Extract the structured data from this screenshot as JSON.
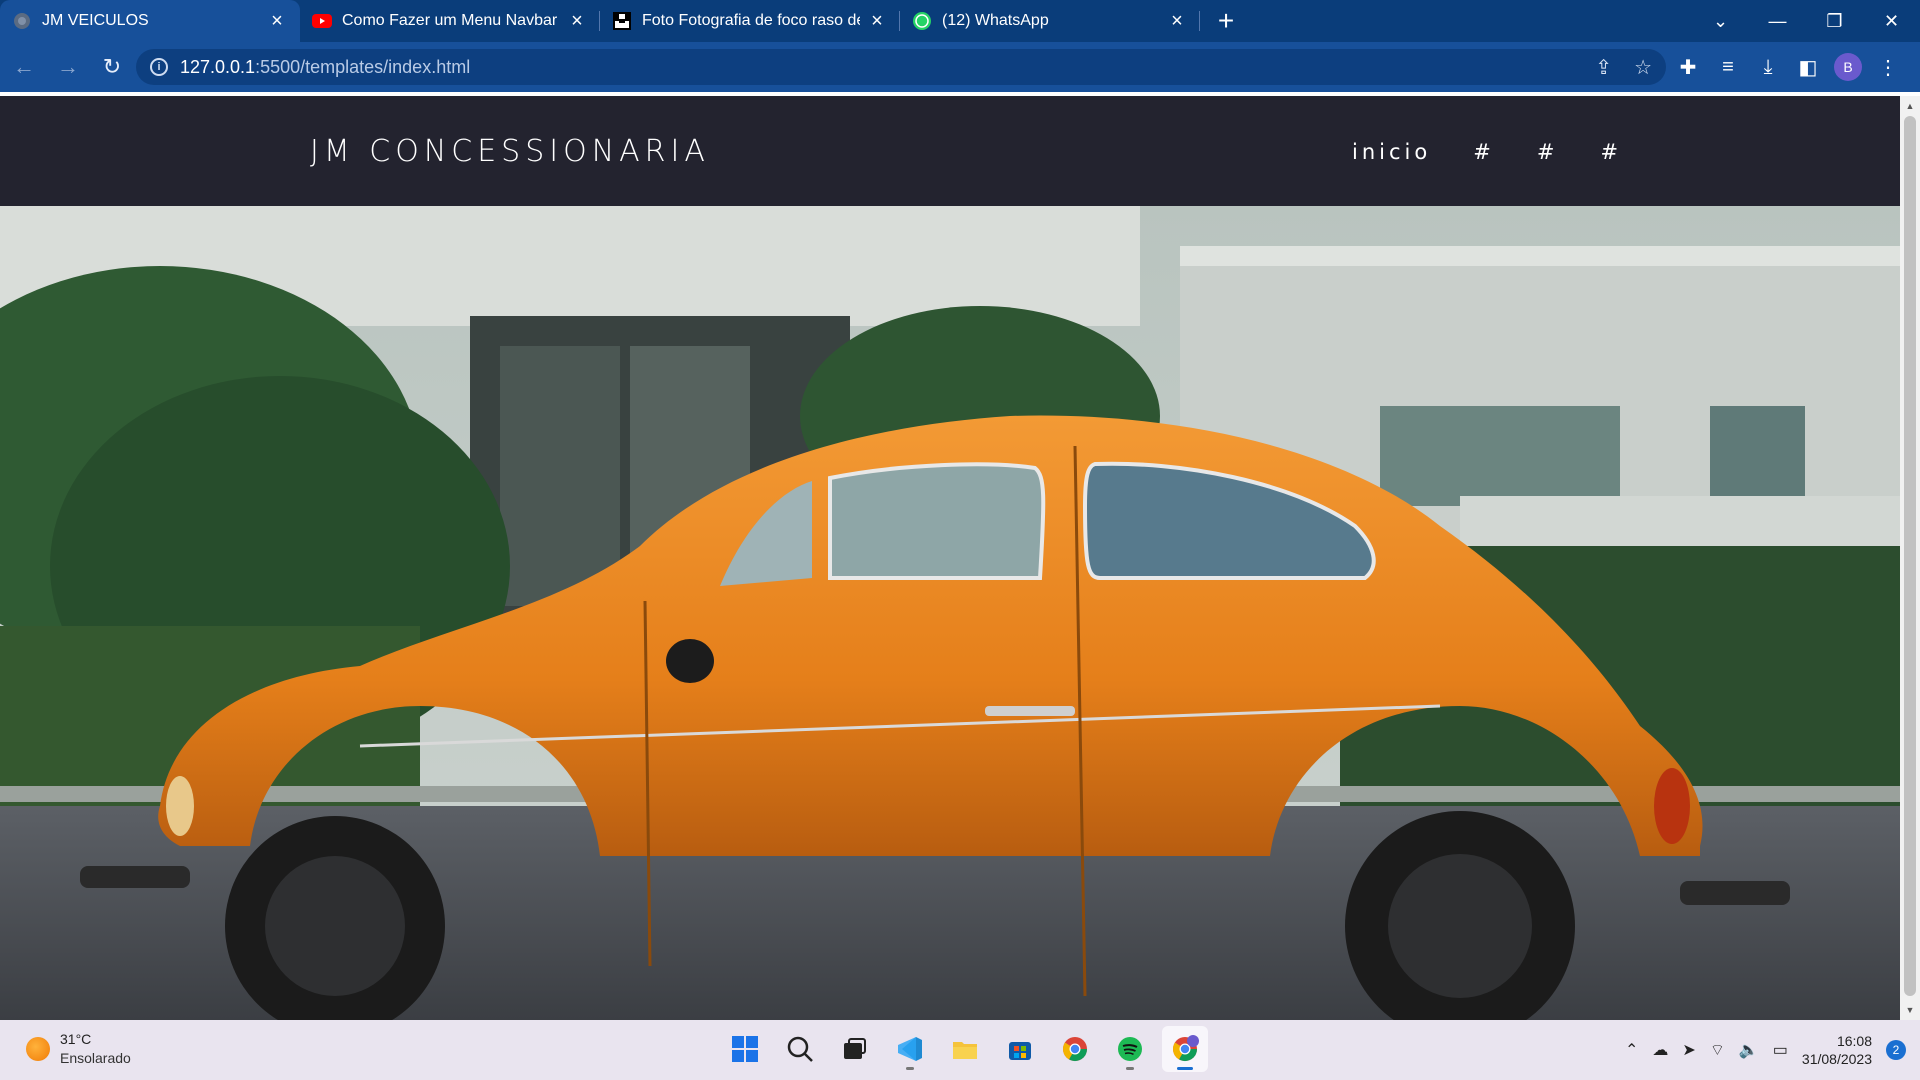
{
  "browser": {
    "tabs": [
      {
        "title": "JM VEICULOS",
        "favicon": "globe-icon",
        "active": true
      },
      {
        "title": "Como Fazer um Menu Navbar Re",
        "favicon": "youtube-icon",
        "active": false
      },
      {
        "title": "Foto Fotografia de foco raso de",
        "favicon": "unsplash-icon",
        "active": false
      },
      {
        "title": "(12) WhatsApp",
        "favicon": "whatsapp-icon",
        "active": false
      }
    ],
    "url_host": "127.0.0.1",
    "url_rest": ":5500/templates/index.html",
    "profile_initial": "B",
    "accent": "#17509a"
  },
  "site": {
    "brand": "JM CONCESSIONARIA",
    "nav": [
      "inicio",
      "#",
      "#",
      "#"
    ],
    "header_bg": "#23232f"
  },
  "taskbar": {
    "temperature": "31°C",
    "weather": "Ensolarado",
    "time": "16:08",
    "date": "31/08/2023",
    "notifications": "2",
    "apps": [
      "start-icon",
      "search-icon",
      "task-view-icon",
      "vscode-icon",
      "file-explorer-icon",
      "store-icon",
      "chrome-icon",
      "spotify-icon",
      "chrome-profile-icon"
    ]
  }
}
